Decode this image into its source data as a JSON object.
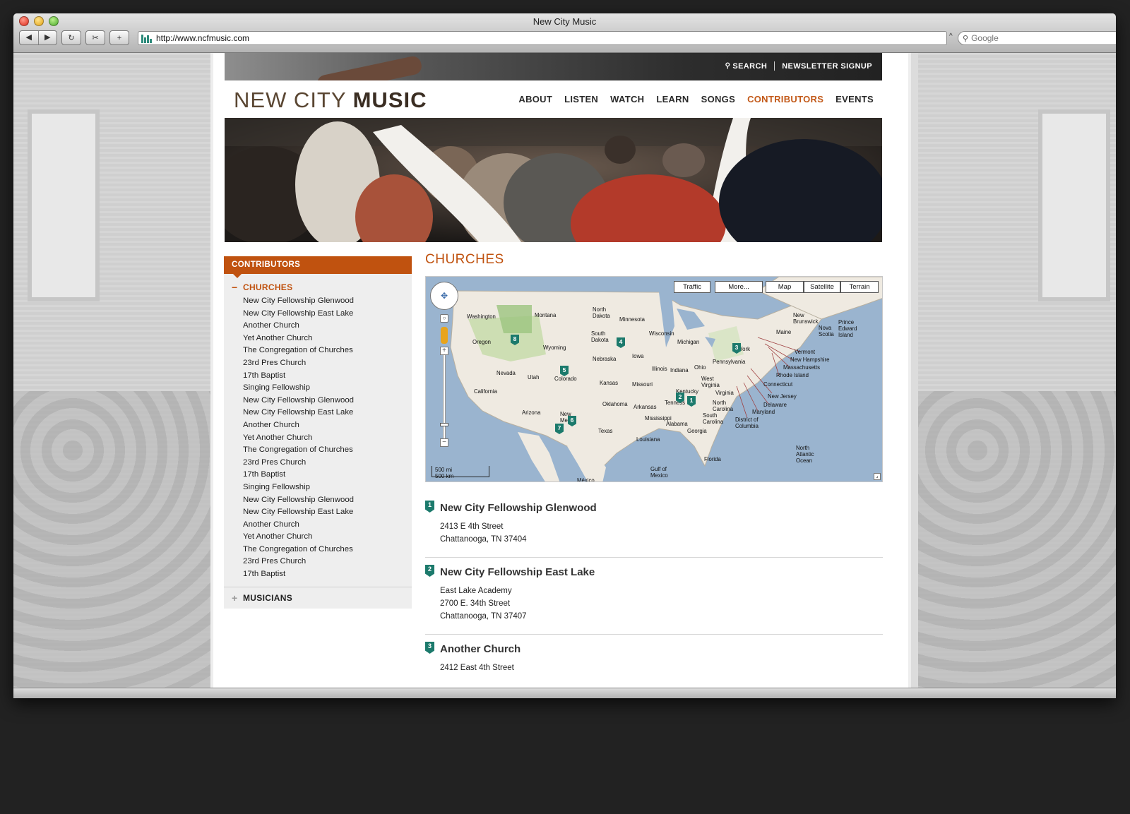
{
  "browser": {
    "title": "New City Music",
    "url": "http://www.ncfmusic.com",
    "search_placeholder": "Google"
  },
  "site": {
    "top_links": {
      "search": "SEARCH",
      "newsletter": "NEWSLETTER SIGNUP"
    },
    "logo": {
      "light": "NEW CITY ",
      "bold": "MUSIC"
    },
    "nav": [
      "ABOUT",
      "LISTEN",
      "WATCH",
      "LEARN",
      "SONGS",
      "CONTRIBUTORS",
      "EVENTS"
    ],
    "active_nav": "CONTRIBUTORS",
    "accent_color": "#c0520f",
    "marker_color": "#1c7a6c"
  },
  "sidebar": {
    "heading": "CONTRIBUTORS",
    "churches_label": "CHURCHES",
    "churches": [
      "New City Fellowship Glenwood",
      "New City Fellowship East Lake",
      "Another Church",
      "Yet Another Church",
      "The Congregation of Churches",
      "23rd Pres Church",
      "17th Baptist",
      "Singing Fellowship",
      "New City Fellowship Glenwood",
      "New City Fellowship East Lake",
      "Another Church",
      "Yet Another Church",
      "The Congregation of Churches",
      "23rd Pres Church",
      "17th Baptist",
      "Singing Fellowship",
      "New City Fellowship Glenwood",
      "New City Fellowship East Lake",
      "Another Church",
      "Yet Another Church",
      "The Congregation of Churches",
      "23rd Pres Church",
      "17th Baptist"
    ],
    "musicians_label": "MUSICIANS"
  },
  "main": {
    "heading": "CHURCHES",
    "map": {
      "buttons": [
        "Traffic",
        "More...",
        "Map",
        "Satellite",
        "Terrain"
      ],
      "scale_mi": "500 mi",
      "scale_km": "500 km",
      "markers": [
        "1",
        "2",
        "3",
        "4",
        "5",
        "6",
        "7",
        "8"
      ]
    },
    "churches": [
      {
        "num": "1",
        "name": "New City Fellowship Glenwood",
        "address": [
          "2413 E 4th Street",
          "Chattanooga, TN 37404"
        ]
      },
      {
        "num": "2",
        "name": "New City Fellowship East Lake",
        "address": [
          "East Lake Academy",
          "2700 E. 34th Street",
          "Chattanooga, TN 37407"
        ]
      },
      {
        "num": "3",
        "name": "Another Church",
        "address": [
          "2412 East 4th Street"
        ]
      }
    ]
  }
}
